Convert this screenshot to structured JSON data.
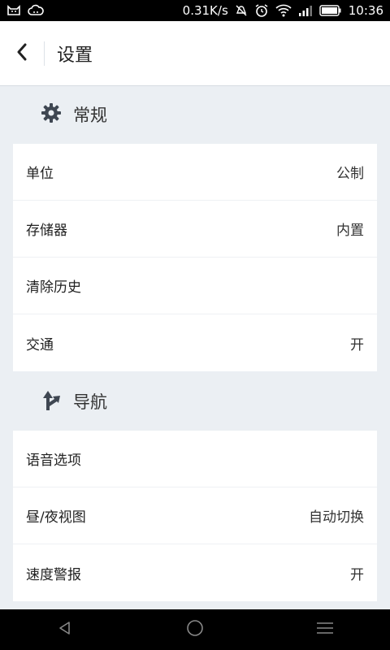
{
  "status_bar": {
    "network_speed": "0.31K/s",
    "time": "10:36",
    "icons": [
      "notification-cat-icon",
      "notification-cloud-icon",
      "mute-icon",
      "alarm-icon",
      "wifi-icon",
      "signal-icon",
      "battery-icon"
    ]
  },
  "header": {
    "title": "设置",
    "back_icon": "back-chevron-icon"
  },
  "sections": [
    {
      "title": "常规",
      "icon": "gear-icon",
      "items": [
        {
          "label": "单位",
          "value": "公制"
        },
        {
          "label": "存储器",
          "value": "内置"
        },
        {
          "label": "清除历史",
          "value": ""
        },
        {
          "label": "交通",
          "value": "开"
        }
      ]
    },
    {
      "title": "导航",
      "icon": "route-arrow-icon",
      "items": [
        {
          "label": "语音选项",
          "value": ""
        },
        {
          "label": "昼/夜视图",
          "value": "自动切换"
        },
        {
          "label": "速度警报",
          "value": "开"
        }
      ]
    }
  ],
  "nav_bar": {
    "icons": [
      "back-triangle-icon",
      "home-circle-icon",
      "menu-icon"
    ]
  },
  "colors": {
    "background": "#ebeff3",
    "card": "#ffffff",
    "icon": "#3f4752",
    "status_bar": "#000000"
  }
}
